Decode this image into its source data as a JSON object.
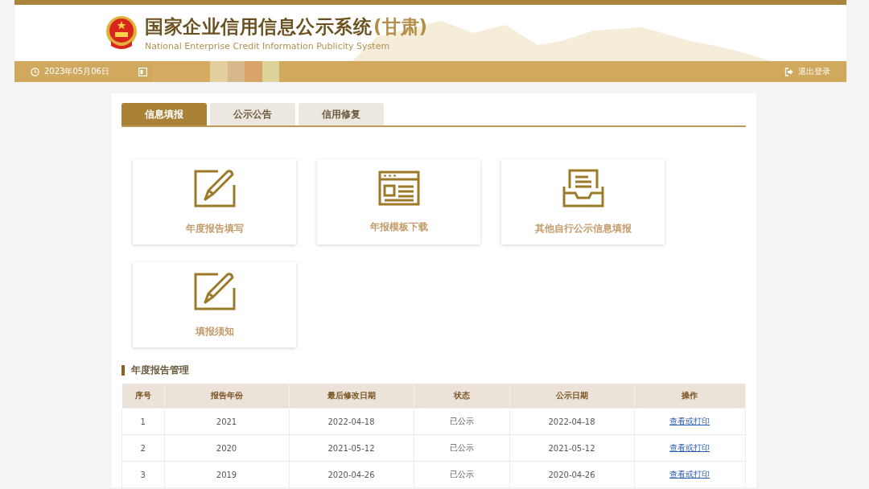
{
  "header": {
    "title": "国家企业信用信息公示系统",
    "region": "(甘肃)",
    "subtitle": "National Enterprise Credit Information Publicity System"
  },
  "info_bar": {
    "date": "2023年05月06日",
    "logout": "退出登录"
  },
  "tabs": [
    {
      "label": "信息填报",
      "selected": true
    },
    {
      "label": "公示公告",
      "selected": false
    },
    {
      "label": "信用修复",
      "selected": false
    }
  ],
  "tiles": [
    {
      "label": "年度报告填写",
      "kind": "edit"
    },
    {
      "label": "年报模板下载",
      "kind": "template"
    },
    {
      "label": "其他自行公示信息填报",
      "kind": "inbox"
    },
    {
      "label": "填报须知",
      "kind": "edit"
    }
  ],
  "section": {
    "title": "年度报告管理"
  },
  "table": {
    "columns": [
      "序号",
      "报告年份",
      "最后修改日期",
      "状态",
      "公示日期",
      "操作"
    ],
    "rows": [
      {
        "cells": [
          "1",
          "2021",
          "2022-04-18",
          "已公示",
          "2022-04-18"
        ],
        "action": "查看或打印"
      },
      {
        "cells": [
          "2",
          "2020",
          "2021-05-12",
          "已公示",
          "2021-05-12"
        ],
        "action": "查看或打印"
      },
      {
        "cells": [
          "3",
          "2019",
          "2020-04-26",
          "已公示",
          "2020-04-26"
        ],
        "action": "查看或打印"
      }
    ]
  }
}
